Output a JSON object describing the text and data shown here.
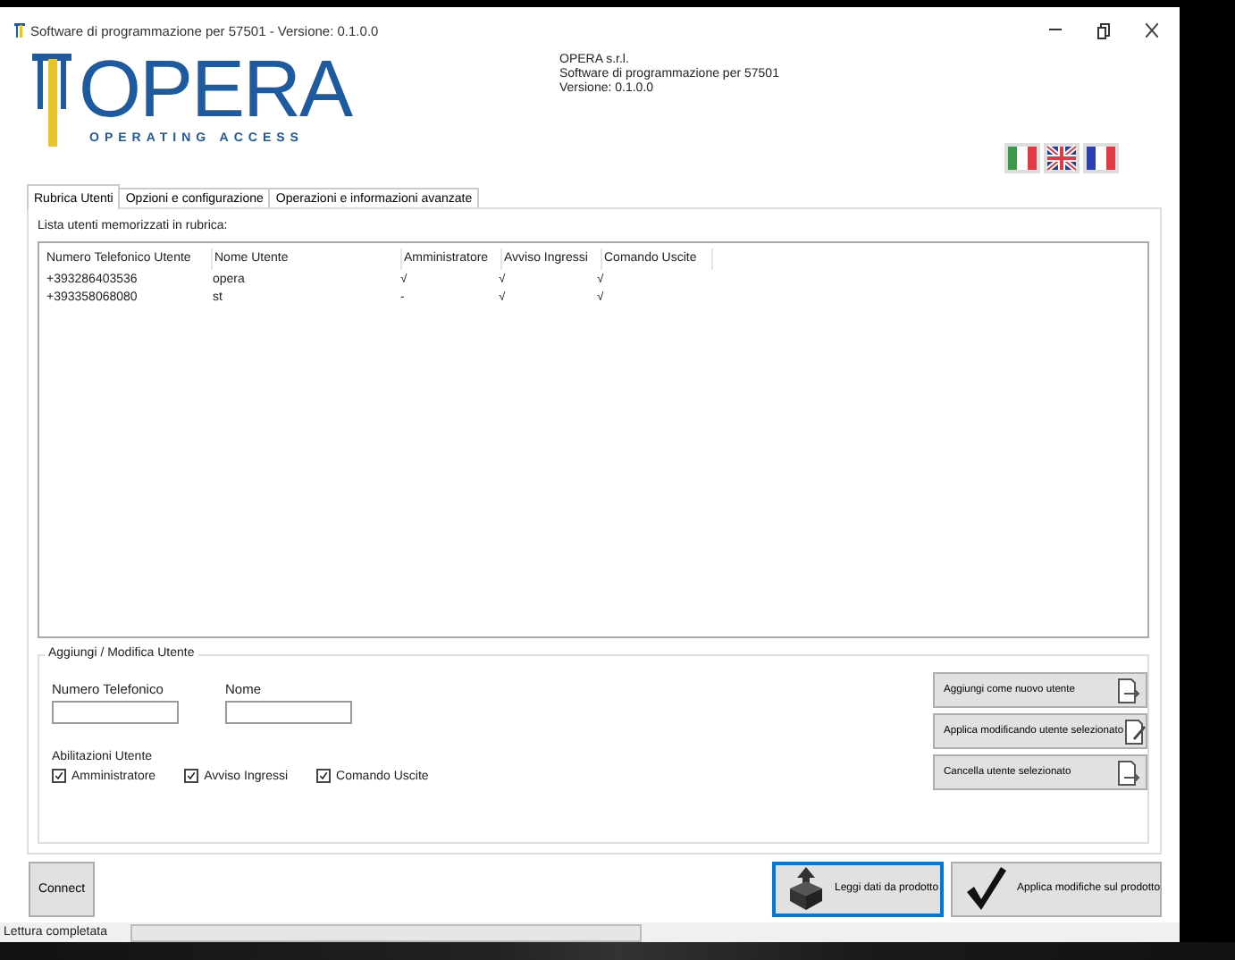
{
  "window": {
    "title": "Software di programmazione per 57501 - Versione: 0.1.0.0"
  },
  "logo": {
    "name": "OPERA",
    "tagline": "OPERATING ACCESS"
  },
  "company_info": [
    "OPERA s.r.l.",
    "Software di programmazione per 57501",
    "Versione: 0.1.0.0"
  ],
  "languages": [
    {
      "kind": "italian"
    },
    {
      "kind": "british"
    },
    {
      "kind": "french"
    }
  ],
  "tabs": [
    {
      "label": "Rubrica Utenti",
      "selected": true
    },
    {
      "label": "Opzioni e configurazione",
      "selected": false
    },
    {
      "label": "Operazioni e informazioni avanzate",
      "selected": false
    }
  ],
  "users_list": {
    "label": "Lista utenti memorizzati in rubrica:",
    "columns": [
      "Numero Telefonico Utente",
      "Nome Utente",
      "Amministratore",
      "Avviso Ingressi",
      "Comando Uscite"
    ],
    "rows": [
      [
        "+393286403536",
        "opera",
        "√",
        "√",
        "√"
      ],
      [
        "+393358068080",
        "st",
        "-",
        "√",
        "√"
      ]
    ]
  },
  "edit_group": {
    "title": "Aggiungi / Modifica Utente",
    "fields": [
      {
        "label": "Numero Telefonico"
      },
      {
        "label": "Nome"
      }
    ],
    "permissions_label": "Abilitazioni Utente",
    "permissions": [
      {
        "label": "Amministratore",
        "checked": true
      },
      {
        "label": "Avviso Ingressi",
        "checked": true
      },
      {
        "label": "Comando Uscite",
        "checked": true
      }
    ],
    "actions": [
      {
        "label": "Aggiungi come nuovo utente",
        "kind": "add"
      },
      {
        "label": "Applica modificando utente selezionato",
        "kind": "edit"
      },
      {
        "label": "Cancella utente selezionato",
        "kind": "delete"
      }
    ]
  },
  "connect_button": "Connect",
  "product_buttons": [
    {
      "label": "Leggi dati da prodotto",
      "kind": "read",
      "focused": true
    },
    {
      "label": "Applica modifiche sul prodotto",
      "kind": "apply",
      "focused": false
    }
  ],
  "status_bar": {
    "text": "Lettura completata",
    "level": 0
  }
}
